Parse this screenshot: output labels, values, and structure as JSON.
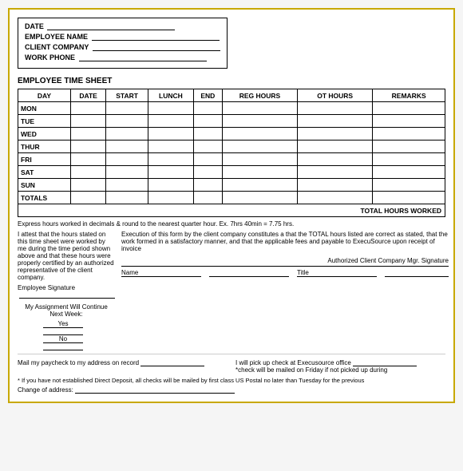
{
  "header": {
    "date_label": "DATE",
    "employee_name_label": "EMPLOYEE NAME",
    "client_company_label": "CLIENT COMPANY",
    "work_phone_label": "WORK PHONE"
  },
  "section_title": "EMPLOYEE TIME SHEET",
  "table": {
    "columns": [
      "DAY",
      "DATE",
      "START",
      "LUNCH",
      "END",
      "REG HOURS",
      "OT HOURS",
      "REMARKS"
    ],
    "rows": [
      {
        "day": "MON"
      },
      {
        "day": "TUE"
      },
      {
        "day": "WED"
      },
      {
        "day": "THUR"
      },
      {
        "day": "FRI"
      },
      {
        "day": "SAT"
      },
      {
        "day": "SUN"
      },
      {
        "day": "TOTALS"
      }
    ],
    "total_hours_label": "TOTAL HOURS WORKED"
  },
  "express_note": "Express hours worked in decimals & round to the nearest quarter hour.  Ex.  7hrs 40min = 7.75 hrs.",
  "attestation": {
    "left_text": "I attest that the hours stated on this time sheet were worked by me during the time period shown above and that these hours were properly certified by an authorized representative of the client company.",
    "employee_sig_label": "Employee Signature",
    "right_text": "Execution of this form by the client company constitutes a that the TOTAL hours listed are correct as stated, that the work formed in a satisfactory manner, and that the applicable fees and payable to ExecuSource upon receipt of invoice",
    "authorized_sig_label": "Authorized Client Company Mgr. Signature"
  },
  "assignment": {
    "label": "My Assignment Will Continue Next Week:",
    "yes_label": "Yes",
    "no_label": "No"
  },
  "bottom": {
    "mail_label": "Mail my paycheck to my address on record",
    "pickup_label": "I will pick up check at Execusource office",
    "check_note": "*check will be mailed on Friday if not picked up during",
    "footer_note": "* If you have not established Direct Deposit, all checks will be mailed by first class US Postal no later than Tuesday for the previous",
    "change_label": "Change of address:"
  },
  "name_label": "Name",
  "title_label": "Title"
}
